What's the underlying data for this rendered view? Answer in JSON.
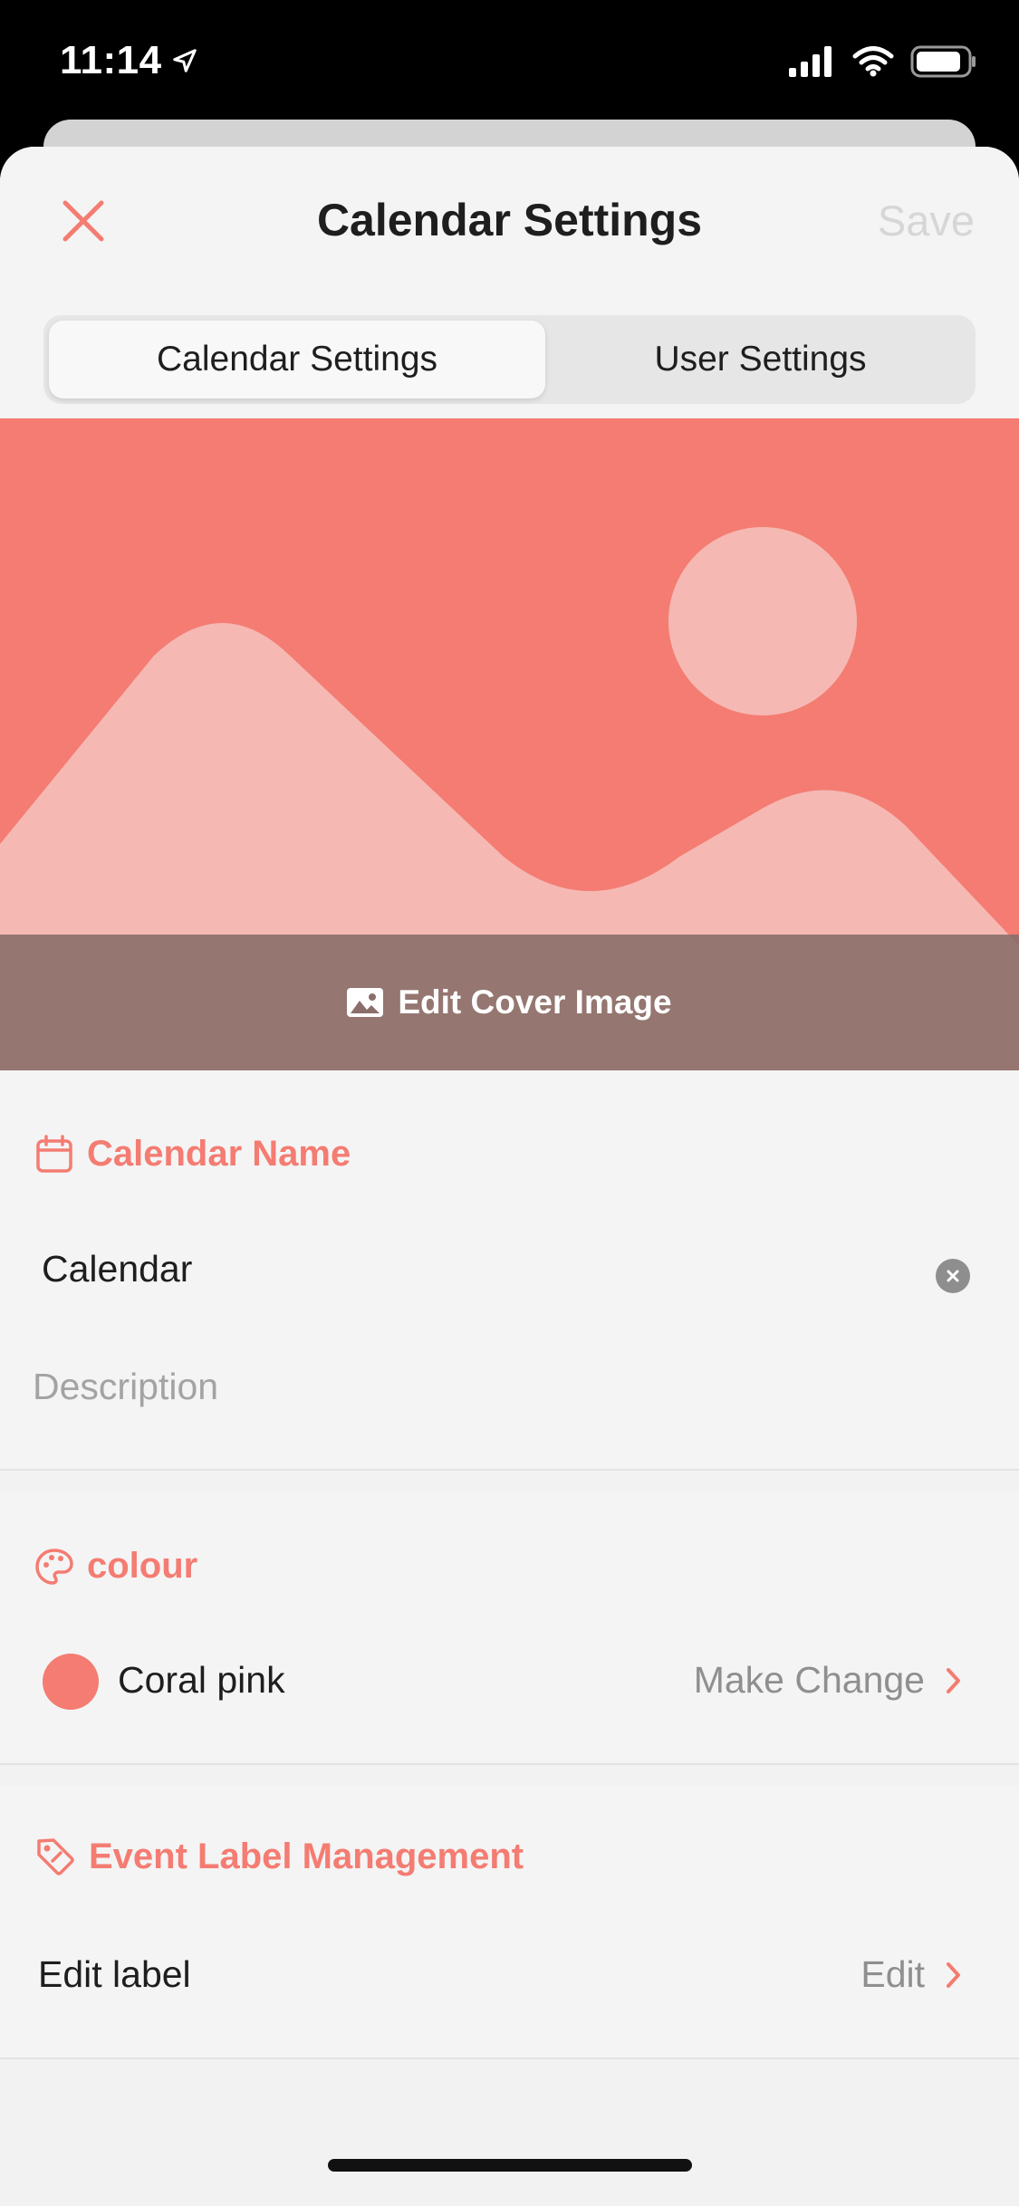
{
  "status_bar": {
    "time": "11:14"
  },
  "navbar": {
    "title": "Calendar Settings",
    "save_label": "Save"
  },
  "segments": {
    "left": "Calendar Settings",
    "right": "User Settings"
  },
  "cover": {
    "edit_label": "Edit Cover Image"
  },
  "calendar_name": {
    "heading": "Calendar Name",
    "value": "Calendar",
    "description_placeholder": "Description"
  },
  "colour": {
    "heading": "colour",
    "name": "Coral pink",
    "change_label": "Make Change",
    "swatch": "#f47c72"
  },
  "labels": {
    "heading": "Event Label Management",
    "row_label": "Edit label",
    "action": "Edit"
  },
  "theme": {
    "accent": "#f47c72"
  }
}
